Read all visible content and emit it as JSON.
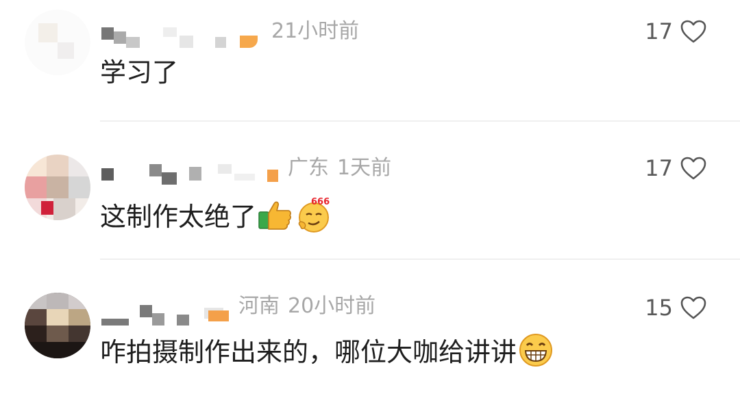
{
  "comments": [
    {
      "location": "",
      "time": "21小时前",
      "text": "学习了",
      "likes": "17",
      "emojis": [],
      "heart_icon": "heart-outline-icon"
    },
    {
      "location": "广东",
      "time": "1天前",
      "text": "这制作太绝了",
      "likes": "17",
      "emojis": [
        "thumbs-up-icon",
        "666-smug-face-icon"
      ],
      "heart_icon": "heart-outline-icon"
    },
    {
      "location": "河南",
      "time": "20小时前",
      "text": "咋拍摄制作出来的，哪位大咖给讲讲",
      "likes": "15",
      "emojis": [
        "grinning-face-icon"
      ],
      "heart_icon": "heart-outline-icon"
    }
  ],
  "emoji_text": {
    "six_six_six": "666"
  },
  "colors": {
    "meta": "#a7a7a7",
    "text": "#1e1e1e",
    "divider": "#efefef",
    "badge": "#f4a04a"
  }
}
